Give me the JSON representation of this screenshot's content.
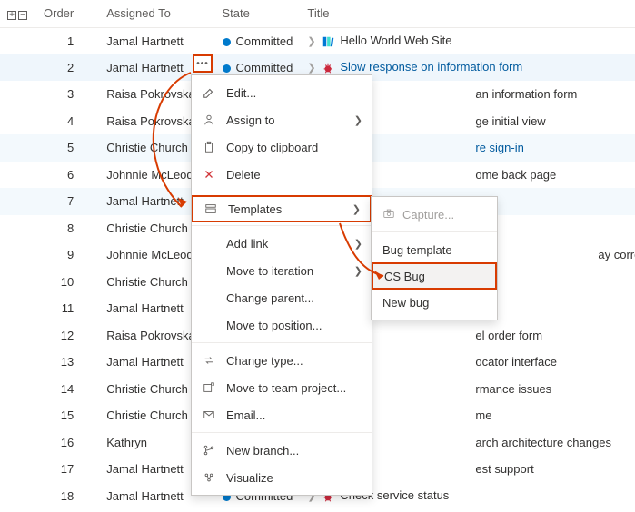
{
  "columns": {
    "order": "Order",
    "assigned": "Assigned To",
    "state": "State",
    "title": "Title"
  },
  "rows": [
    {
      "order": 1,
      "assigned": "Jamal Hartnett",
      "state": "Committed",
      "title": "Hello World Web Site",
      "type": "book",
      "sel": false,
      "link": false
    },
    {
      "order": 2,
      "assigned": "Jamal Hartnett",
      "state": "Committed",
      "title": "Slow response on information form",
      "type": "bug",
      "sel": true,
      "link": true
    },
    {
      "order": 3,
      "assigned": "Raisa Pokrovskaya",
      "state": "",
      "title": "an information form",
      "type": "",
      "sel": false,
      "link": false,
      "trunc": true
    },
    {
      "order": 4,
      "assigned": "Raisa Pokrovskaya",
      "state": "",
      "title": "ge initial view",
      "type": "",
      "sel": false,
      "link": false,
      "trunc": true
    },
    {
      "order": 5,
      "assigned": "Christie Church",
      "state": "",
      "title": "re sign-in",
      "type": "",
      "sel": false,
      "link": true,
      "trunc": true,
      "hl": true
    },
    {
      "order": 6,
      "assigned": "Johnnie McLeod",
      "state": "",
      "title": "ome back page",
      "type": "",
      "sel": false,
      "link": false,
      "trunc": true
    },
    {
      "order": 7,
      "assigned": "Jamal Hartnett",
      "state": "",
      "title": "",
      "type": "",
      "sel": false,
      "link": false,
      "trunc": true,
      "hl": true
    },
    {
      "order": 8,
      "assigned": "Christie Church",
      "state": "",
      "title": "",
      "type": "",
      "sel": false,
      "link": false,
      "trunc": true
    },
    {
      "order": 9,
      "assigned": "Johnnie McLeod",
      "state": "",
      "title": "ay correctly",
      "type": "",
      "sel": false,
      "link": false,
      "trunc": true,
      "far": true
    },
    {
      "order": 10,
      "assigned": "Christie Church",
      "state": "",
      "title": "",
      "type": "",
      "sel": false,
      "link": false,
      "trunc": true
    },
    {
      "order": 11,
      "assigned": "Jamal Hartnett",
      "state": "",
      "title": "",
      "type": "",
      "sel": false,
      "link": false,
      "trunc": true
    },
    {
      "order": 12,
      "assigned": "Raisa Pokrovskaya",
      "state": "",
      "title": "el order form",
      "type": "",
      "sel": false,
      "link": false,
      "trunc": true
    },
    {
      "order": 13,
      "assigned": "Jamal Hartnett",
      "state": "",
      "title": "ocator interface",
      "type": "",
      "sel": false,
      "link": false,
      "trunc": true
    },
    {
      "order": 14,
      "assigned": "Christie Church",
      "state": "",
      "title": "rmance issues",
      "type": "",
      "sel": false,
      "link": false,
      "trunc": true
    },
    {
      "order": 15,
      "assigned": "Christie Church",
      "state": "",
      "title": "me",
      "type": "",
      "sel": false,
      "link": false,
      "trunc": true
    },
    {
      "order": 16,
      "assigned": "Kathryn",
      "state": "",
      "title": "arch architecture changes",
      "type": "",
      "sel": false,
      "link": false,
      "trunc": true
    },
    {
      "order": 17,
      "assigned": "Jamal Hartnett",
      "state": "",
      "title": "est support",
      "type": "",
      "sel": false,
      "link": false,
      "trunc": true
    },
    {
      "order": 18,
      "assigned": "Jamal Hartnett",
      "state": "Committed",
      "title": "Check service status",
      "type": "bug",
      "sel": false,
      "link": false
    }
  ],
  "menu": {
    "edit": "Edit...",
    "assign": "Assign to",
    "copy": "Copy to clipboard",
    "delete": "Delete",
    "templates": "Templates",
    "addlink": "Add link",
    "moveiter": "Move to iteration",
    "changeparent": "Change parent...",
    "movepos": "Move to position...",
    "changetype": "Change type...",
    "moveteam": "Move to team project...",
    "email": "Email...",
    "newbranch": "New branch...",
    "visualize": "Visualize"
  },
  "submenu": {
    "capture": "Capture...",
    "bugtemplate": "Bug template",
    "csbug": "CS Bug",
    "newbug": "New bug"
  }
}
